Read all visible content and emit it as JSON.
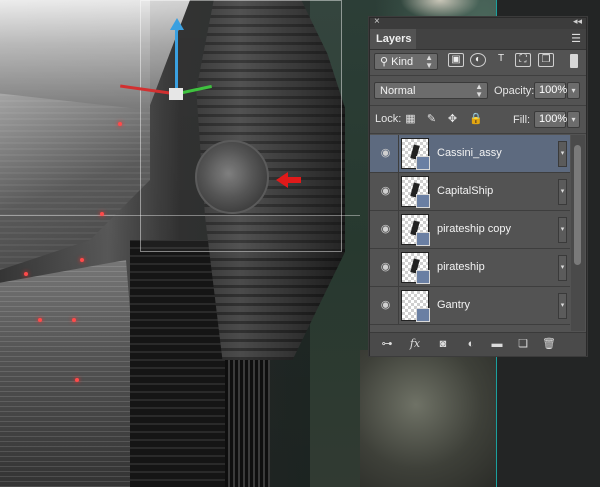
{
  "panel": {
    "tab_label": "Layers",
    "close_glyph": "×",
    "collapse_glyph": "◂◂",
    "menu_glyph": "☰"
  },
  "filter": {
    "kind_label": "Kind",
    "icons": [
      "image-filter-icon",
      "adjustment-filter-icon",
      "type-filter-icon",
      "shape-filter-icon",
      "smart-object-filter-icon"
    ]
  },
  "blend": {
    "mode": "Normal",
    "opacity_label": "Opacity:",
    "opacity_value": "100%"
  },
  "lock": {
    "label": "Lock:",
    "fill_label": "Fill:",
    "fill_value": "100%"
  },
  "layers": [
    {
      "name": "Cassini_assy",
      "selected": true
    },
    {
      "name": "CapitalShip",
      "selected": false
    },
    {
      "name": "pirateship copy",
      "selected": false
    },
    {
      "name": "pirateship",
      "selected": false
    },
    {
      "name": "Gantry",
      "selected": false
    }
  ],
  "footer_icons": [
    "link-icon",
    "fx-icon",
    "mask-icon",
    "adjustment-icon",
    "folder-icon",
    "new-layer-icon",
    "trash-icon"
  ],
  "colors": {
    "panel_bg": "#535353",
    "selected_layer": "#5d6a7f",
    "gizmo_y": "#3aa0e0",
    "gizmo_x": "#d23030",
    "gizmo_z": "#3fc23f",
    "marker_red": "#e01a1a"
  }
}
